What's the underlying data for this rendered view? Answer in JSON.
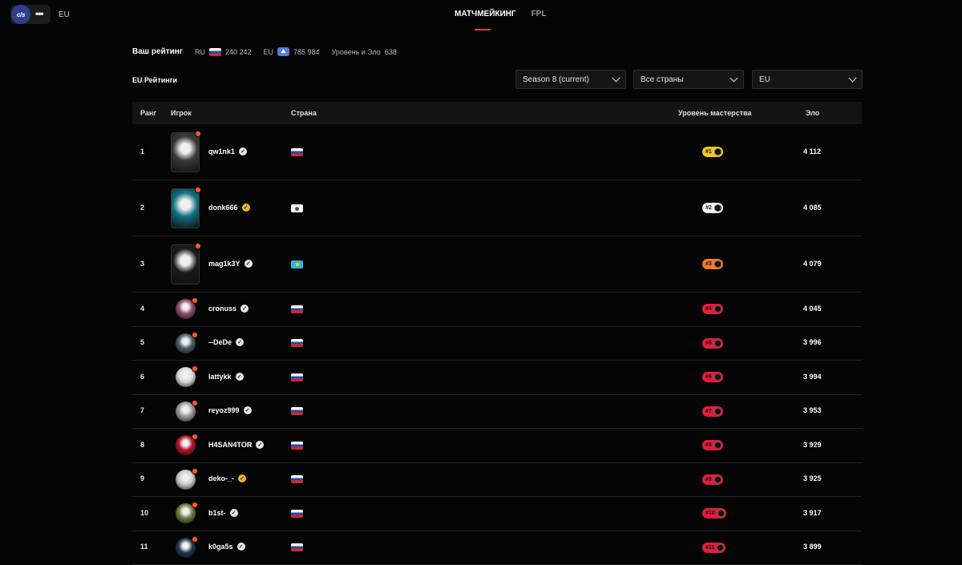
{
  "topbar": {
    "logo_text": "c/s",
    "more": "•••",
    "region": "EU",
    "tabs": [
      {
        "label": "МАТЧМЕЙКИНГ",
        "active": true
      },
      {
        "label": "FPL",
        "active": false
      }
    ]
  },
  "summary": {
    "title": "Ваш рейтинг",
    "ru_label": "RU",
    "ru_value": "240 242",
    "eu_label": "EU",
    "eu_value": "785 984",
    "level_elo_label": "Уровень и Эло",
    "level_elo_value": "638"
  },
  "section_title": "EU Рейтинги",
  "filters": {
    "season": "Season 8 (current)",
    "country": "Все страны",
    "region": "EU"
  },
  "table": {
    "headers": {
      "rank": "Ранг",
      "player": "Игрок",
      "country": "Страна",
      "level": "Уровень мастерства",
      "elo": "Эло"
    },
    "rows": [
      {
        "rank": "1",
        "nick": "qw1nk1",
        "country": "ru",
        "level": "#1",
        "elo": "4 112",
        "verified": "white",
        "badge_color": "#f4c51c",
        "avatar": "#3a3a3a"
      },
      {
        "rank": "2",
        "nick": "donk666",
        "country": "kr",
        "level": "#2",
        "elo": "4 085",
        "verified": "gold",
        "badge_color": "#e8f4ff",
        "avatar": "#0f6f83"
      },
      {
        "rank": "3",
        "nick": "mag1k3Y",
        "country": "kz",
        "level": "#3",
        "elo": "4 079",
        "verified": "white",
        "badge_color": "#f07a2a",
        "avatar": "#1a1a1a"
      },
      {
        "rank": "4",
        "nick": "cronuss",
        "country": "ru",
        "level": "#4",
        "elo": "4 045",
        "verified": "white",
        "badge_color": "#e01e3c",
        "avatar": "#8a4a6a"
      },
      {
        "rank": "5",
        "nick": "--DeDe",
        "country": "ru",
        "level": "#5",
        "elo": "3 996",
        "verified": "white",
        "badge_color": "#e01e3c",
        "avatar": "#4a5a6a"
      },
      {
        "rank": "6",
        "nick": "lattykk",
        "country": "ru",
        "level": "#6",
        "elo": "3 994",
        "verified": "white",
        "badge_color": "#e01e3c",
        "avatar": "#d8d8d8"
      },
      {
        "rank": "7",
        "nick": "reyoz999",
        "country": "ru",
        "level": "#7",
        "elo": "3 953",
        "verified": "white",
        "badge_color": "#e01e3c",
        "avatar": "#9a9a9a"
      },
      {
        "rank": "8",
        "nick": "H4SAN4TOR",
        "country": "ru",
        "level": "#8",
        "elo": "3 929",
        "verified": "white",
        "badge_color": "#e01e3c",
        "avatar": "#b3102a"
      },
      {
        "rank": "9",
        "nick": "deko-_-",
        "country": "ru",
        "level": "#9",
        "elo": "3 925",
        "verified": "gold",
        "badge_color": "#e01e3c",
        "avatar": "#c8c8c8"
      },
      {
        "rank": "10",
        "nick": "b1st-",
        "country": "ru",
        "level": "#10",
        "elo": "3 917",
        "verified": "white",
        "badge_color": "#e01e3c",
        "avatar": "#6b7a3a"
      },
      {
        "rank": "11",
        "nick": "k0ga5s",
        "country": "ru",
        "level": "#11",
        "elo": "3 899",
        "verified": "white",
        "badge_color": "#e01e3c",
        "avatar": "#1f3550"
      }
    ]
  }
}
